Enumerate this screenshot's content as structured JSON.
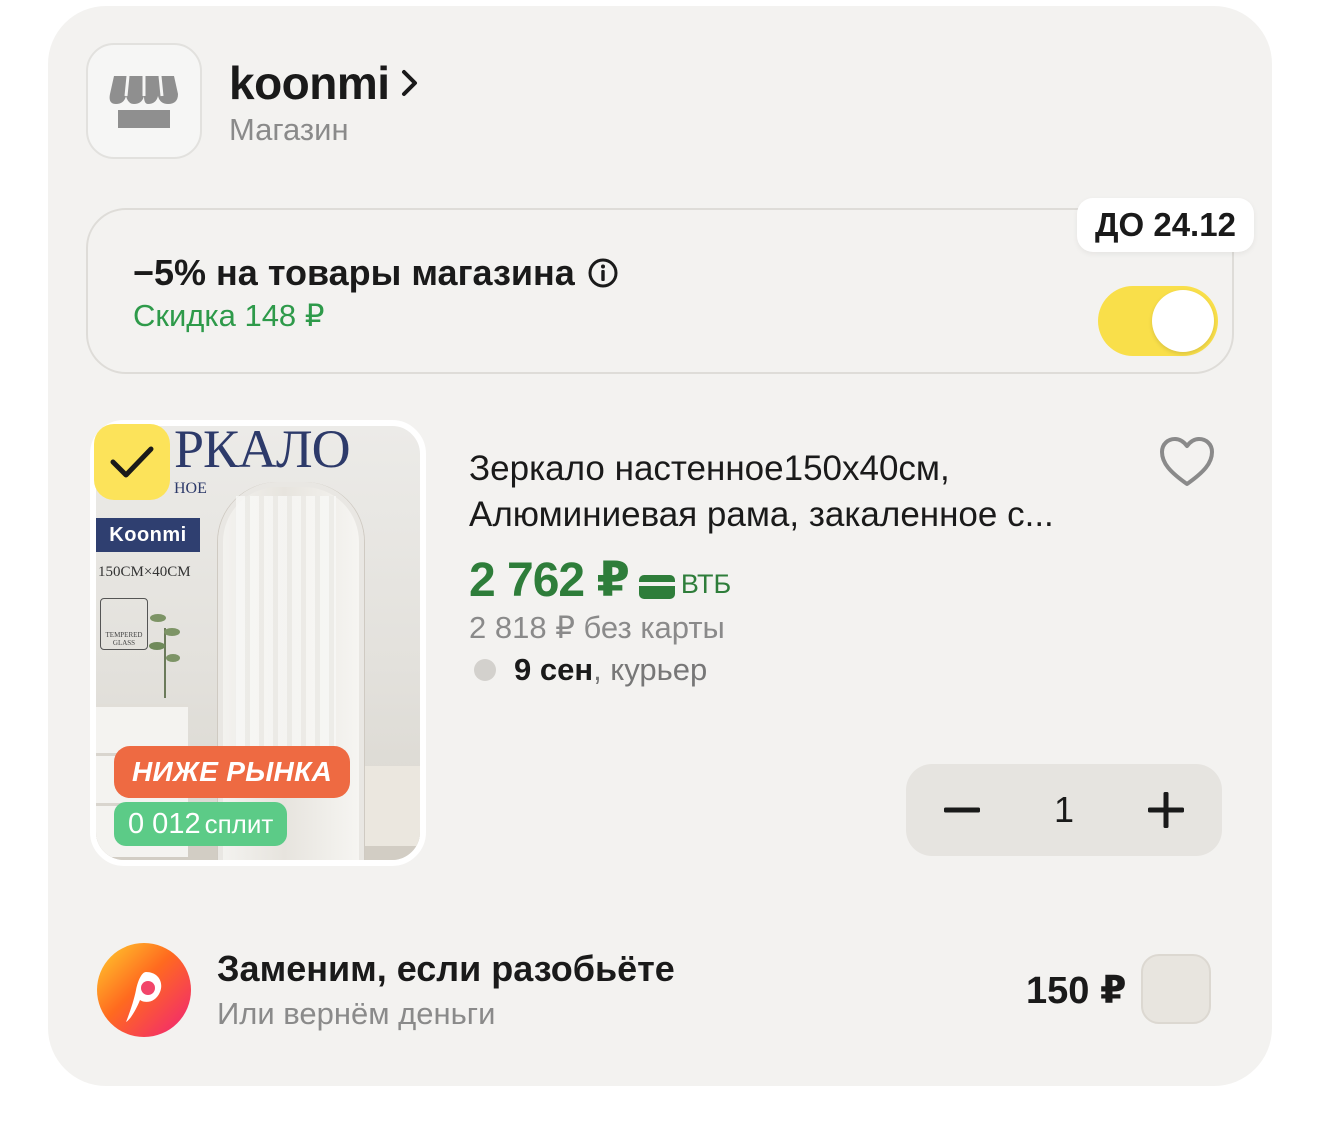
{
  "shop": {
    "name": "koonmi",
    "subtitle": "Магазин",
    "logo_icon": "shop-awning-icon"
  },
  "promo": {
    "badge": "ДО 24.12",
    "title": "−5% на товары магазина",
    "discount": "Скидка 148 ₽",
    "toggle_on": true,
    "accent": "#f9df4a",
    "discount_color": "#2e9a4a"
  },
  "product": {
    "selected": true,
    "image": {
      "heading": "РКАЛО",
      "subheading": "НОЕ",
      "brand": "Koonmi",
      "size": "150CM×40CM",
      "glass_label": "TEMPERED GLASS"
    },
    "badges": {
      "market": "НИЖЕ РЫНКА",
      "split_amount": "0 012",
      "split_label": "сплит"
    },
    "title_line1": "Зеркало настенное150x40см,",
    "title_line2": "Алюминиевая рама, закаленное с...",
    "price_main": "2 762 ₽",
    "price_bank": "ВТБ",
    "price_old": "2 818 ₽  без карты",
    "delivery_date": "9 сен",
    "delivery_method": ", курьер",
    "quantity": "1",
    "price_color": "#2e7d3a"
  },
  "insurance": {
    "title": "Заменим, если разобьёте",
    "subtitle": "Или вернём деньги",
    "price": "150 ₽",
    "checked": false
  }
}
